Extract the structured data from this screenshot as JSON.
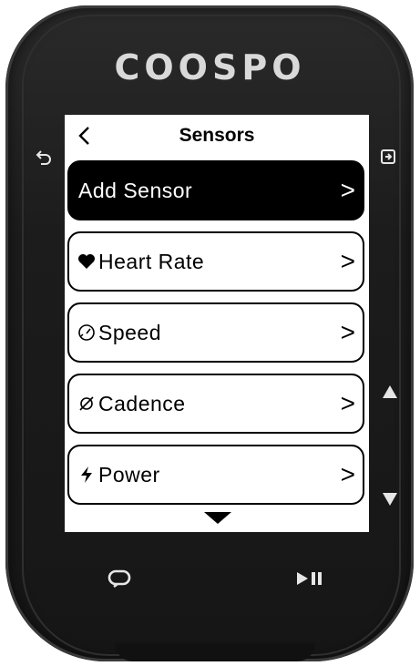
{
  "device": {
    "brand": "COOSPO"
  },
  "buttons": {
    "back": "↶",
    "enter": "⏎",
    "up": "▲",
    "down": "▼",
    "loop": "⟳",
    "play_pause": "▶II"
  },
  "screen": {
    "title": "Sensors",
    "back_glyph": "<",
    "items": [
      {
        "label": "Add Sensor",
        "icon": "",
        "chevron": ">",
        "selected": true
      },
      {
        "label": "Heart Rate",
        "icon": "heart-icon",
        "chevron": ">",
        "selected": false
      },
      {
        "label": "Speed",
        "icon": "speedometer-icon",
        "chevron": ">",
        "selected": false
      },
      {
        "label": "Cadence",
        "icon": "cadence-icon",
        "chevron": ">",
        "selected": false
      },
      {
        "label": "Power",
        "icon": "lightning-icon",
        "chevron": ">",
        "selected": false
      }
    ]
  },
  "colors": {
    "device_body": "#1c1c1c",
    "selected_bg": "#000000",
    "screen_bg": "#ffffff"
  }
}
